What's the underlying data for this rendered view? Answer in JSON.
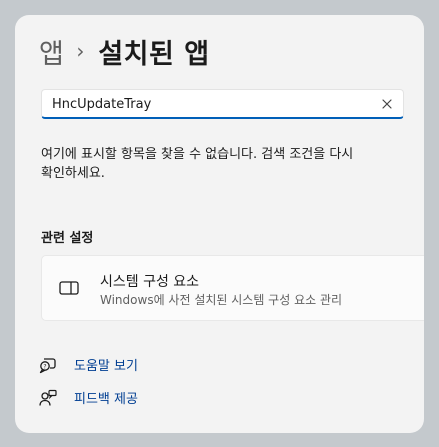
{
  "breadcrumb": {
    "parent": "앱",
    "separator": "›",
    "current": "설치된 앱"
  },
  "search": {
    "value": "HncUpdateTray",
    "clear_icon": "close-icon"
  },
  "empty_message": "여기에 표시할 항목을 찾을 수 없습니다. 검색 조건을 다시 확인하세요.",
  "related_settings": {
    "title": "관련 설정",
    "items": [
      {
        "title": "시스템 구성 요소",
        "subtitle": "Windows에 사전 설치된 시스템 구성 요소 관리",
        "icon": "system-components-icon"
      }
    ]
  },
  "help_links": [
    {
      "label": "도움말 보기",
      "icon": "help-chat-icon"
    },
    {
      "label": "피드백 제공",
      "icon": "feedback-icon"
    }
  ],
  "colors": {
    "accent": "#005fb8",
    "link": "#003e92",
    "background": "#f3f3f3"
  }
}
